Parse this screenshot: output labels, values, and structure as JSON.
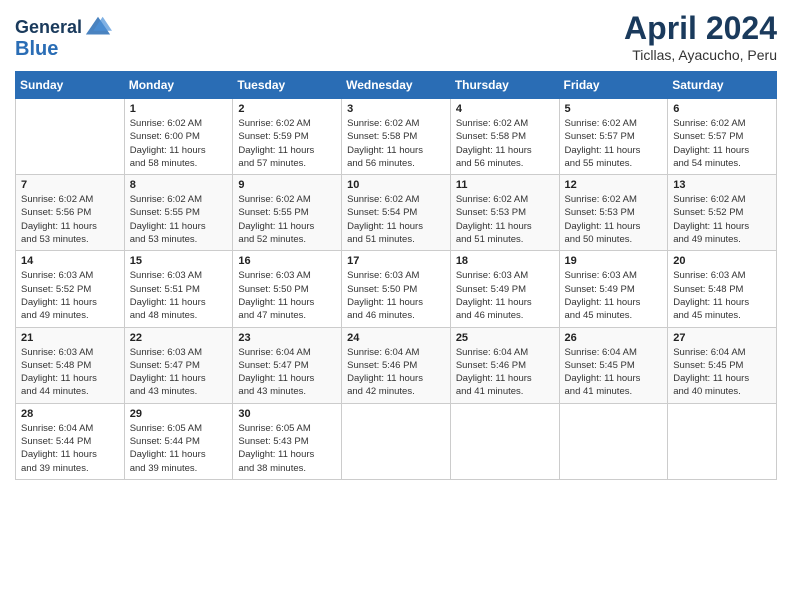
{
  "header": {
    "logo_line1": "General",
    "logo_line2": "Blue",
    "month_year": "April 2024",
    "location": "Ticllas, Ayacucho, Peru"
  },
  "days_of_week": [
    "Sunday",
    "Monday",
    "Tuesday",
    "Wednesday",
    "Thursday",
    "Friday",
    "Saturday"
  ],
  "weeks": [
    [
      {
        "day": "",
        "info": ""
      },
      {
        "day": "1",
        "info": "Sunrise: 6:02 AM\nSunset: 6:00 PM\nDaylight: 11 hours\nand 58 minutes."
      },
      {
        "day": "2",
        "info": "Sunrise: 6:02 AM\nSunset: 5:59 PM\nDaylight: 11 hours\nand 57 minutes."
      },
      {
        "day": "3",
        "info": "Sunrise: 6:02 AM\nSunset: 5:58 PM\nDaylight: 11 hours\nand 56 minutes."
      },
      {
        "day": "4",
        "info": "Sunrise: 6:02 AM\nSunset: 5:58 PM\nDaylight: 11 hours\nand 56 minutes."
      },
      {
        "day": "5",
        "info": "Sunrise: 6:02 AM\nSunset: 5:57 PM\nDaylight: 11 hours\nand 55 minutes."
      },
      {
        "day": "6",
        "info": "Sunrise: 6:02 AM\nSunset: 5:57 PM\nDaylight: 11 hours\nand 54 minutes."
      }
    ],
    [
      {
        "day": "7",
        "info": "Sunrise: 6:02 AM\nSunset: 5:56 PM\nDaylight: 11 hours\nand 53 minutes."
      },
      {
        "day": "8",
        "info": "Sunrise: 6:02 AM\nSunset: 5:55 PM\nDaylight: 11 hours\nand 53 minutes."
      },
      {
        "day": "9",
        "info": "Sunrise: 6:02 AM\nSunset: 5:55 PM\nDaylight: 11 hours\nand 52 minutes."
      },
      {
        "day": "10",
        "info": "Sunrise: 6:02 AM\nSunset: 5:54 PM\nDaylight: 11 hours\nand 51 minutes."
      },
      {
        "day": "11",
        "info": "Sunrise: 6:02 AM\nSunset: 5:53 PM\nDaylight: 11 hours\nand 51 minutes."
      },
      {
        "day": "12",
        "info": "Sunrise: 6:02 AM\nSunset: 5:53 PM\nDaylight: 11 hours\nand 50 minutes."
      },
      {
        "day": "13",
        "info": "Sunrise: 6:02 AM\nSunset: 5:52 PM\nDaylight: 11 hours\nand 49 minutes."
      }
    ],
    [
      {
        "day": "14",
        "info": "Sunrise: 6:03 AM\nSunset: 5:52 PM\nDaylight: 11 hours\nand 49 minutes."
      },
      {
        "day": "15",
        "info": "Sunrise: 6:03 AM\nSunset: 5:51 PM\nDaylight: 11 hours\nand 48 minutes."
      },
      {
        "day": "16",
        "info": "Sunrise: 6:03 AM\nSunset: 5:50 PM\nDaylight: 11 hours\nand 47 minutes."
      },
      {
        "day": "17",
        "info": "Sunrise: 6:03 AM\nSunset: 5:50 PM\nDaylight: 11 hours\nand 46 minutes."
      },
      {
        "day": "18",
        "info": "Sunrise: 6:03 AM\nSunset: 5:49 PM\nDaylight: 11 hours\nand 46 minutes."
      },
      {
        "day": "19",
        "info": "Sunrise: 6:03 AM\nSunset: 5:49 PM\nDaylight: 11 hours\nand 45 minutes."
      },
      {
        "day": "20",
        "info": "Sunrise: 6:03 AM\nSunset: 5:48 PM\nDaylight: 11 hours\nand 45 minutes."
      }
    ],
    [
      {
        "day": "21",
        "info": "Sunrise: 6:03 AM\nSunset: 5:48 PM\nDaylight: 11 hours\nand 44 minutes."
      },
      {
        "day": "22",
        "info": "Sunrise: 6:03 AM\nSunset: 5:47 PM\nDaylight: 11 hours\nand 43 minutes."
      },
      {
        "day": "23",
        "info": "Sunrise: 6:04 AM\nSunset: 5:47 PM\nDaylight: 11 hours\nand 43 minutes."
      },
      {
        "day": "24",
        "info": "Sunrise: 6:04 AM\nSunset: 5:46 PM\nDaylight: 11 hours\nand 42 minutes."
      },
      {
        "day": "25",
        "info": "Sunrise: 6:04 AM\nSunset: 5:46 PM\nDaylight: 11 hours\nand 41 minutes."
      },
      {
        "day": "26",
        "info": "Sunrise: 6:04 AM\nSunset: 5:45 PM\nDaylight: 11 hours\nand 41 minutes."
      },
      {
        "day": "27",
        "info": "Sunrise: 6:04 AM\nSunset: 5:45 PM\nDaylight: 11 hours\nand 40 minutes."
      }
    ],
    [
      {
        "day": "28",
        "info": "Sunrise: 6:04 AM\nSunset: 5:44 PM\nDaylight: 11 hours\nand 39 minutes."
      },
      {
        "day": "29",
        "info": "Sunrise: 6:05 AM\nSunset: 5:44 PM\nDaylight: 11 hours\nand 39 minutes."
      },
      {
        "day": "30",
        "info": "Sunrise: 6:05 AM\nSunset: 5:43 PM\nDaylight: 11 hours\nand 38 minutes."
      },
      {
        "day": "",
        "info": ""
      },
      {
        "day": "",
        "info": ""
      },
      {
        "day": "",
        "info": ""
      },
      {
        "day": "",
        "info": ""
      }
    ]
  ]
}
